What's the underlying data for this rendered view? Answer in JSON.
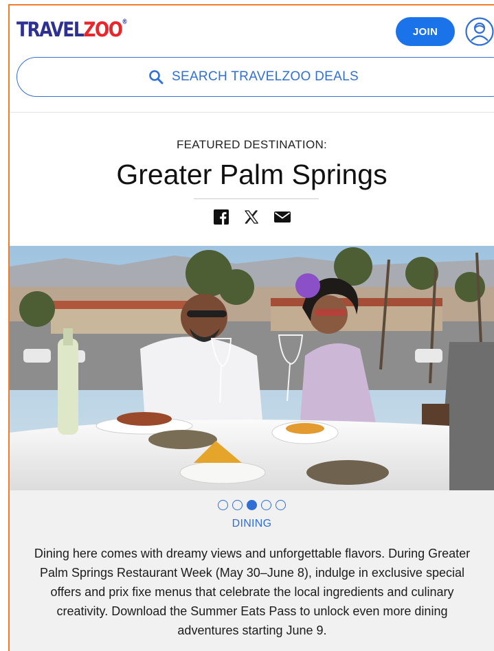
{
  "header": {
    "logo_main": "TRAVEL",
    "logo_accent": "ZOO",
    "logo_mark": "®",
    "join_label": "JOIN",
    "search_label": "SEARCH TRAVELZOO DEALS"
  },
  "featured": {
    "eyebrow": "FEATURED DESTINATION:",
    "title": "Greater Palm Springs",
    "share_icons": [
      "facebook-icon",
      "x-icon",
      "email-icon"
    ]
  },
  "carousel": {
    "slide_count": 5,
    "active_index": 2,
    "category": "DINING",
    "description": "Dining here comes with dreamy views and unforgettable flavors. During Greater Palm Springs Restaurant Week (May 30–June 8), indulge in exclusive special offers and prix fixe menus that celebrate the local ingredients and culinary creativity. Download the Summer Eats Pass to unlock even more dining adventures starting June 9."
  },
  "colors": {
    "accent_blue": "#1a73e8",
    "link_blue": "#2f6fd6",
    "frame_orange": "#ee7d2b",
    "logo_blue": "#2e3192",
    "logo_red": "#e8262c"
  }
}
